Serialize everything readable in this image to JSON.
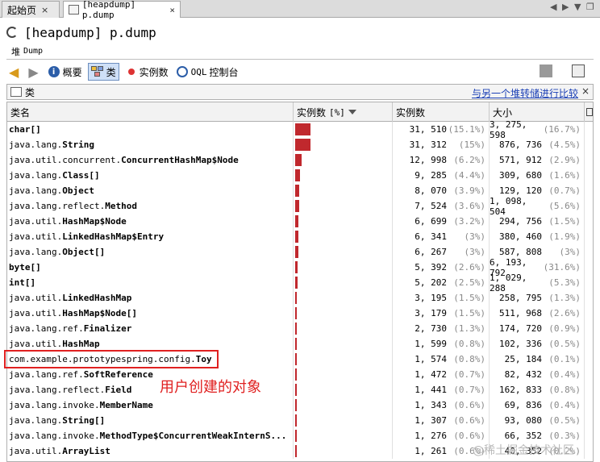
{
  "tabs": [
    {
      "label": "起始页",
      "close": "×"
    },
    {
      "label": "[heapdump] p.dump",
      "close": "×"
    }
  ],
  "tab_nav": {
    "left": "◀",
    "right": "▶",
    "list": "▼",
    "window": "❐"
  },
  "title": "[heapdump] p.dump",
  "heap_label": "堆",
  "heap_sub": "Dump",
  "toolbar": {
    "summary": "概要",
    "classes": "类",
    "instances": "实例数",
    "oql_prefix": "OQL",
    "oql_label": "控制台"
  },
  "panel": {
    "title": "类",
    "compare_link": "与另一个堆转储进行比较",
    "close": "×"
  },
  "table": {
    "headers": [
      "类名",
      "实例数",
      "[%]",
      "实例数",
      "大小"
    ],
    "max_instances": 31510,
    "rows": [
      {
        "pkg": "",
        "cls": "char[]",
        "count": "31, 510",
        "count_pct": "(15.1%)",
        "size": "3, 275, 598",
        "size_pct": "(16.7%)",
        "value": 31510
      },
      {
        "pkg": "java.lang.",
        "cls": "String",
        "count": "31, 312",
        "count_pct": "(15%)",
        "size": "876, 736",
        "size_pct": "(4.5%)",
        "value": 31312
      },
      {
        "pkg": "java.util.concurrent.",
        "cls": "ConcurrentHashMap$Node",
        "count": "12, 998",
        "count_pct": "(6.2%)",
        "size": "571, 912",
        "size_pct": "(2.9%)",
        "value": 12998
      },
      {
        "pkg": "java.lang.",
        "cls": "Class[]",
        "count": "9, 285",
        "count_pct": "(4.4%)",
        "size": "309, 680",
        "size_pct": "(1.6%)",
        "value": 9285
      },
      {
        "pkg": "java.lang.",
        "cls": "Object",
        "count": "8, 070",
        "count_pct": "(3.9%)",
        "size": "129, 120",
        "size_pct": "(0.7%)",
        "value": 8070
      },
      {
        "pkg": "java.lang.reflect.",
        "cls": "Method",
        "count": "7, 524",
        "count_pct": "(3.6%)",
        "size": "1, 098, 504",
        "size_pct": "(5.6%)",
        "value": 7524
      },
      {
        "pkg": "java.util.",
        "cls": "HashMap$Node",
        "count": "6, 699",
        "count_pct": "(3.2%)",
        "size": "294, 756",
        "size_pct": "(1.5%)",
        "value": 6699
      },
      {
        "pkg": "java.util.",
        "cls": "LinkedHashMap$Entry",
        "count": "6, 341",
        "count_pct": "(3%)",
        "size": "380, 460",
        "size_pct": "(1.9%)",
        "value": 6341
      },
      {
        "pkg": "java.lang.",
        "cls": "Object[]",
        "count": "6, 267",
        "count_pct": "(3%)",
        "size": "587, 808",
        "size_pct": "(3%)",
        "value": 6267
      },
      {
        "pkg": "",
        "cls": "byte[]",
        "count": "5, 392",
        "count_pct": "(2.6%)",
        "size": "6, 193, 792",
        "size_pct": "(31.6%)",
        "value": 5392
      },
      {
        "pkg": "",
        "cls": "int[]",
        "count": "5, 202",
        "count_pct": "(2.5%)",
        "size": "1, 029, 288",
        "size_pct": "(5.3%)",
        "value": 5202
      },
      {
        "pkg": "java.util.",
        "cls": "LinkedHashMap",
        "count": "3, 195",
        "count_pct": "(1.5%)",
        "size": "258, 795",
        "size_pct": "(1.3%)",
        "value": 3195
      },
      {
        "pkg": "java.util.",
        "cls": "HashMap$Node[]",
        "count": "3, 179",
        "count_pct": "(1.5%)",
        "size": "511, 968",
        "size_pct": "(2.6%)",
        "value": 3179
      },
      {
        "pkg": "java.lang.ref.",
        "cls": "Finalizer",
        "count": "2, 730",
        "count_pct": "(1.3%)",
        "size": "174, 720",
        "size_pct": "(0.9%)",
        "value": 2730
      },
      {
        "pkg": "java.util.",
        "cls": "HashMap",
        "count": "1, 599",
        "count_pct": "(0.8%)",
        "size": "102, 336",
        "size_pct": "(0.5%)",
        "value": 1599
      },
      {
        "pkg": "com.example.prototypespring.config.",
        "cls": "Toy",
        "count": "1, 574",
        "count_pct": "(0.8%)",
        "size": "25, 184",
        "size_pct": "(0.1%)",
        "value": 1574
      },
      {
        "pkg": "java.lang.ref.",
        "cls": "SoftReference",
        "count": "1, 472",
        "count_pct": "(0.7%)",
        "size": "82, 432",
        "size_pct": "(0.4%)",
        "value": 1472
      },
      {
        "pkg": "java.lang.reflect.",
        "cls": "Field",
        "count": "1, 441",
        "count_pct": "(0.7%)",
        "size": "162, 833",
        "size_pct": "(0.8%)",
        "value": 1441
      },
      {
        "pkg": "java.lang.invoke.",
        "cls": "MemberName",
        "count": "1, 343",
        "count_pct": "(0.6%)",
        "size": "69, 836",
        "size_pct": "(0.4%)",
        "value": 1343
      },
      {
        "pkg": "java.lang.",
        "cls": "String[]",
        "count": "1, 307",
        "count_pct": "(0.6%)",
        "size": "93, 080",
        "size_pct": "(0.5%)",
        "value": 1307
      },
      {
        "pkg": "java.lang.invoke.",
        "cls": "MethodType$ConcurrentWeakInternS...",
        "count": "1, 276",
        "count_pct": "(0.6%)",
        "size": "66, 352",
        "size_pct": "(0.3%)",
        "value": 1276
      },
      {
        "pkg": "java.util.",
        "cls": "ArrayList",
        "count": "1, 261",
        "count_pct": "(0.6%)",
        "size": "40, 352",
        "size_pct": "(0.2%)",
        "value": 1261
      }
    ]
  },
  "annotation": "用户创建的对象",
  "watermark": "@稀土掘金技术社区",
  "colors": {
    "bar": "#c0282d",
    "highlight": "#e02020",
    "link": "#1a3fb5"
  }
}
